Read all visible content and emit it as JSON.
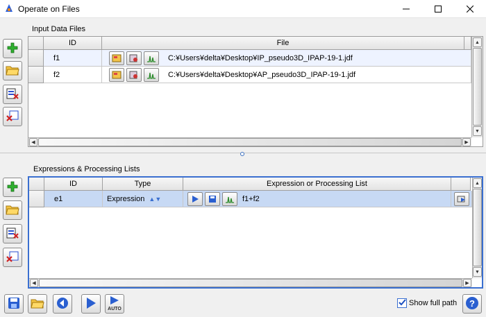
{
  "window": {
    "title": "Operate on Files"
  },
  "input_section": {
    "title": "Input Data Files",
    "columns": [
      "ID",
      "File"
    ],
    "rows": [
      {
        "id": "f1",
        "file": "C:¥Users¥delta¥Desktop¥IP_pseudo3D_IPAP-19-1.jdf"
      },
      {
        "id": "f2",
        "file": "C:¥Users¥delta¥Desktop¥AP_pseudo3D_IPAP-19-1.jdf"
      }
    ]
  },
  "expr_section": {
    "title": "Expressions & Processing Lists",
    "columns": [
      "ID",
      "Type",
      "Expression or Processing List"
    ],
    "rows": [
      {
        "id": "e1",
        "type": "Expression",
        "expression": "f1+f2"
      }
    ]
  },
  "footer": {
    "show_full_path_label": "Show full path",
    "show_full_path_checked": true,
    "auto_label": "AUTO"
  },
  "icons": [
    "app-icon",
    "add-icon",
    "open-folder-icon",
    "remove-row-icon",
    "delete-icon",
    "open-file-icon",
    "process-icon",
    "spectrum-icon",
    "play-icon",
    "save-icon",
    "back-icon",
    "forward-icon",
    "auto-forward-icon",
    "help-icon"
  ]
}
